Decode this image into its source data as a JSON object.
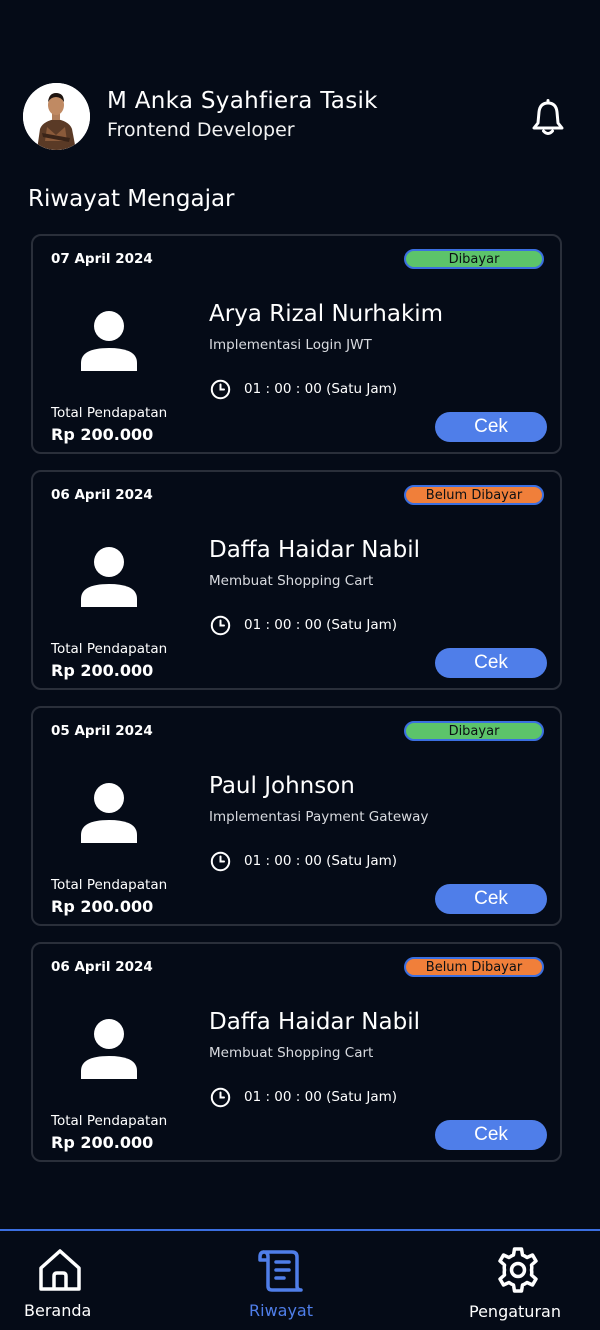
{
  "header": {
    "name": "M Anka Syahfiera Tasik",
    "role": "Frontend Developer"
  },
  "section_title": "Riwayat Mengajar",
  "cards": [
    {
      "date": "07 April 2024",
      "status": "Dibayar",
      "student": "Arya Rizal Nurhakim",
      "topic": "Implementasi Login JWT",
      "duration": "01 : 00 : 00 (Satu Jam)",
      "earning_label": "Total Pendapatan",
      "earning": "Rp 200.000",
      "button": "Cek"
    },
    {
      "date": "06 April 2024",
      "status": "Belum Dibayar",
      "student": "Daffa Haidar Nabil",
      "topic": "Membuat Shopping Cart",
      "duration": "01 : 00 : 00 (Satu Jam)",
      "earning_label": "Total Pendapatan",
      "earning": "Rp 200.000",
      "button": "Cek"
    },
    {
      "date": "05 April 2024",
      "status": "Dibayar",
      "student": "Paul Johnson",
      "topic": "Implementasi Payment Gateway",
      "duration": "01 : 00 : 00 (Satu Jam)",
      "earning_label": "Total Pendapatan",
      "earning": "Rp 200.000",
      "button": "Cek"
    },
    {
      "date": "06 April 2024",
      "status": "Belum Dibayar",
      "student": "Daffa Haidar Nabil",
      "topic": "Membuat Shopping Cart",
      "duration": "01 : 00 : 00 (Satu Jam)",
      "earning_label": "Total Pendapatan",
      "earning": "Rp 200.000",
      "button": "Cek"
    }
  ],
  "nav": {
    "home": "Beranda",
    "history": "Riwayat",
    "settings": "Pengaturan",
    "active": "history"
  },
  "colors": {
    "background": "#050b17",
    "accent": "#4f7ee9",
    "paid": "#5cc46a",
    "unpaid": "#f07f3a"
  },
  "icons": {
    "notification": "bell-icon",
    "student": "person-icon",
    "duration": "clock-icon",
    "home": "home-icon",
    "history": "scroll-icon",
    "settings": "gear-icon"
  }
}
